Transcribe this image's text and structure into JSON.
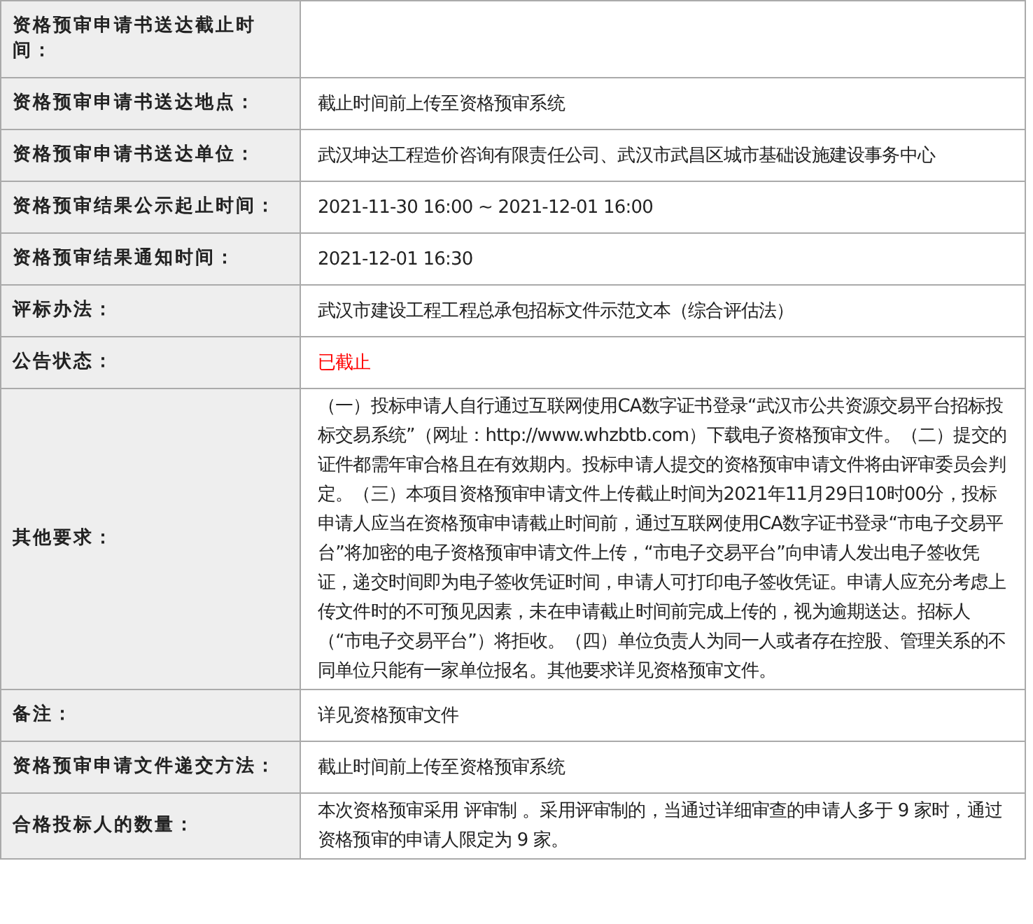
{
  "rows": [
    {
      "label": "资格预审申请书送达截止时间：",
      "value": ""
    },
    {
      "label": "资格预审申请书送达地点：",
      "value": "截止时间前上传至资格预审系统"
    },
    {
      "label": "资格预审申请书送达单位：",
      "value": "武汉坤达工程造价咨询有限责任公司、武汉市武昌区城市基础设施建设事务中心"
    },
    {
      "label": "资格预审结果公示起止时间：",
      "value": "2021-11-30 16:00 ~ 2021-12-01 16:00"
    },
    {
      "label": "资格预审结果通知时间：",
      "value": "2021-12-01 16:30"
    },
    {
      "label": "评标办法：",
      "value": "武汉市建设工程工程总承包招标文件示范文本（综合评估法）"
    },
    {
      "label": "公告状态：",
      "value": "已截止",
      "color": "#ff0000"
    },
    {
      "label": "其他要求：",
      "value": "（一）投标申请人自行通过互联网使用CA数字证书登录“武汉市公共资源交易平台招标投标交易系统”（网址：http://www.whzbtb.com）下载电子资格预审文件。（二）提交的证件都需年审合格且在有效期内。投标申请人提交的资格预审申请文件将由评审委员会判定。（三）本项目资格预审申请文件上传截止时间为2021年11月29日10时00分，投标申请人应当在资格预审申请截止时间前，通过互联网使用CA数字证书登录“市电子交易平台”将加密的电子资格预审申请文件上传，“市电子交易平台”向申请人发出电子签收凭证，递交时间即为电子签收凭证时间，申请人可打印电子签收凭证。申请人应充分考虑上传文件时的不可预见因素，未在申请截止时间前完成上传的，视为逾期送达。招标人（“市电子交易平台”）将拒收。（四）单位负责人为同一人或者存在控股、管理关系的不同单位只能有一家单位报名。其他要求详见资格预审文件。"
    },
    {
      "label": "备注：",
      "value": "详见资格预审文件"
    },
    {
      "label": "资格预审申请文件递交方法：",
      "value": "截止时间前上传至资格预审系统"
    },
    {
      "label": "合格投标人的数量：",
      "value": "本次资格预审采用 评审制 。采用评审制的，当通过详细审查的申请人多于 9 家时，通过资格预审的申请人限定为 9 家。"
    }
  ]
}
